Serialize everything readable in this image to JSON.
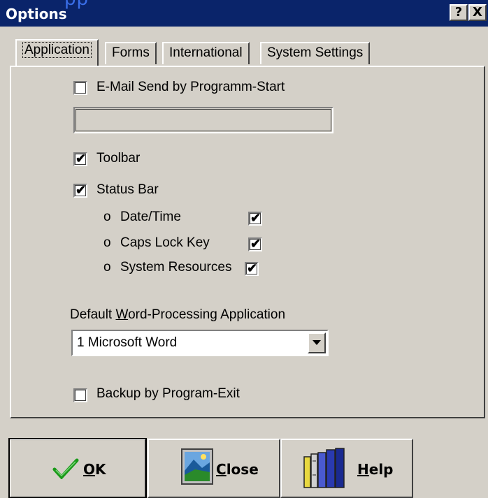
{
  "window": {
    "title": "Options",
    "top_overflow_text": "pp",
    "help_glyph": "?",
    "close_glyph": "X"
  },
  "tabs": [
    {
      "label": "Application",
      "active": true
    },
    {
      "label": "Forms",
      "active": false
    },
    {
      "label": "International",
      "active": false
    },
    {
      "label": "System Settings",
      "active": false
    }
  ],
  "application": {
    "email_send": {
      "label": "E-Mail Send by Programm-Start",
      "checked": false
    },
    "email_field": {
      "value": ""
    },
    "toolbar": {
      "label": "Toolbar",
      "checked": true
    },
    "status_bar": {
      "label": "Status Bar",
      "checked": true
    },
    "status_items": [
      {
        "bullet": "o",
        "label": "Date/Time",
        "checked": true
      },
      {
        "bullet": "o",
        "label": "Caps Lock Key",
        "checked": true
      },
      {
        "bullet": "o",
        "label": "System Resources",
        "checked": true
      }
    ],
    "word_processing": {
      "label_pre": "Default ",
      "label_mnemonic": "W",
      "label_post": "ord-Processing Application",
      "selected": "1 Microsoft Word"
    },
    "backup": {
      "label": "Backup by Program-Exit",
      "checked": false
    }
  },
  "buttons": {
    "ok": {
      "mnemonic": "O",
      "rest": "K",
      "icon": "green-checkmark-icon"
    },
    "close": {
      "mnemonic": "C",
      "rest": "lose",
      "icon": "landscape-picture-icon"
    },
    "help": {
      "mnemonic": "H",
      "rest": "elp",
      "icon": "books-icon"
    }
  },
  "colors": {
    "titlebar": "#0a246a",
    "face": "#d4d0c8",
    "check_green": "#1a9a1a"
  }
}
